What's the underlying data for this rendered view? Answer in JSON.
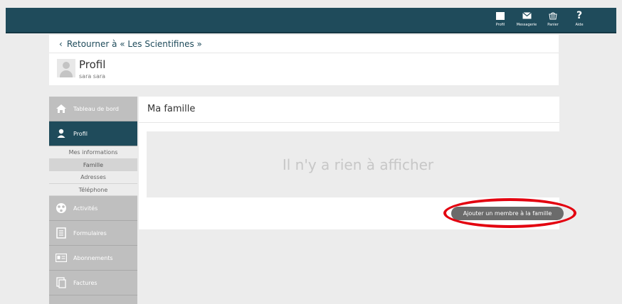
{
  "topbar": {
    "nav": [
      {
        "label": "Profil",
        "icon": "profile-icon"
      },
      {
        "label": "Messagerie",
        "icon": "envelope-icon"
      },
      {
        "label": "Panier",
        "icon": "basket-icon"
      },
      {
        "label": "Aide",
        "icon": "question-icon"
      }
    ],
    "help_glyph": "?",
    "color": "#1f4b5b"
  },
  "header": {
    "back_link": "Retourner à « Les Scientifines »",
    "back_chevron": "‹",
    "title": "Profil",
    "username": "sara sara"
  },
  "sidebar": {
    "items": [
      {
        "label": "Tableau de bord",
        "icon": "home-icon"
      },
      {
        "label": "Profil",
        "icon": "user-icon",
        "active": true
      },
      {
        "label": "Activités",
        "icon": "activities-icon"
      },
      {
        "label": "Formulaires",
        "icon": "form-icon"
      },
      {
        "label": "Abonnements",
        "icon": "membership-card-icon"
      },
      {
        "label": "Factures",
        "icon": "invoice-icon"
      }
    ],
    "subitems": [
      {
        "label": "Mes informations"
      },
      {
        "label": "Famille",
        "active": true
      },
      {
        "label": "Adresses"
      },
      {
        "label": "Téléphone"
      }
    ]
  },
  "main": {
    "title": "Ma famille",
    "empty_message": "Il n'y a rien à afficher",
    "add_button": "Ajouter un membre à la famille"
  },
  "annotation": {
    "color": "#e3000f",
    "shape": "ellipse"
  }
}
